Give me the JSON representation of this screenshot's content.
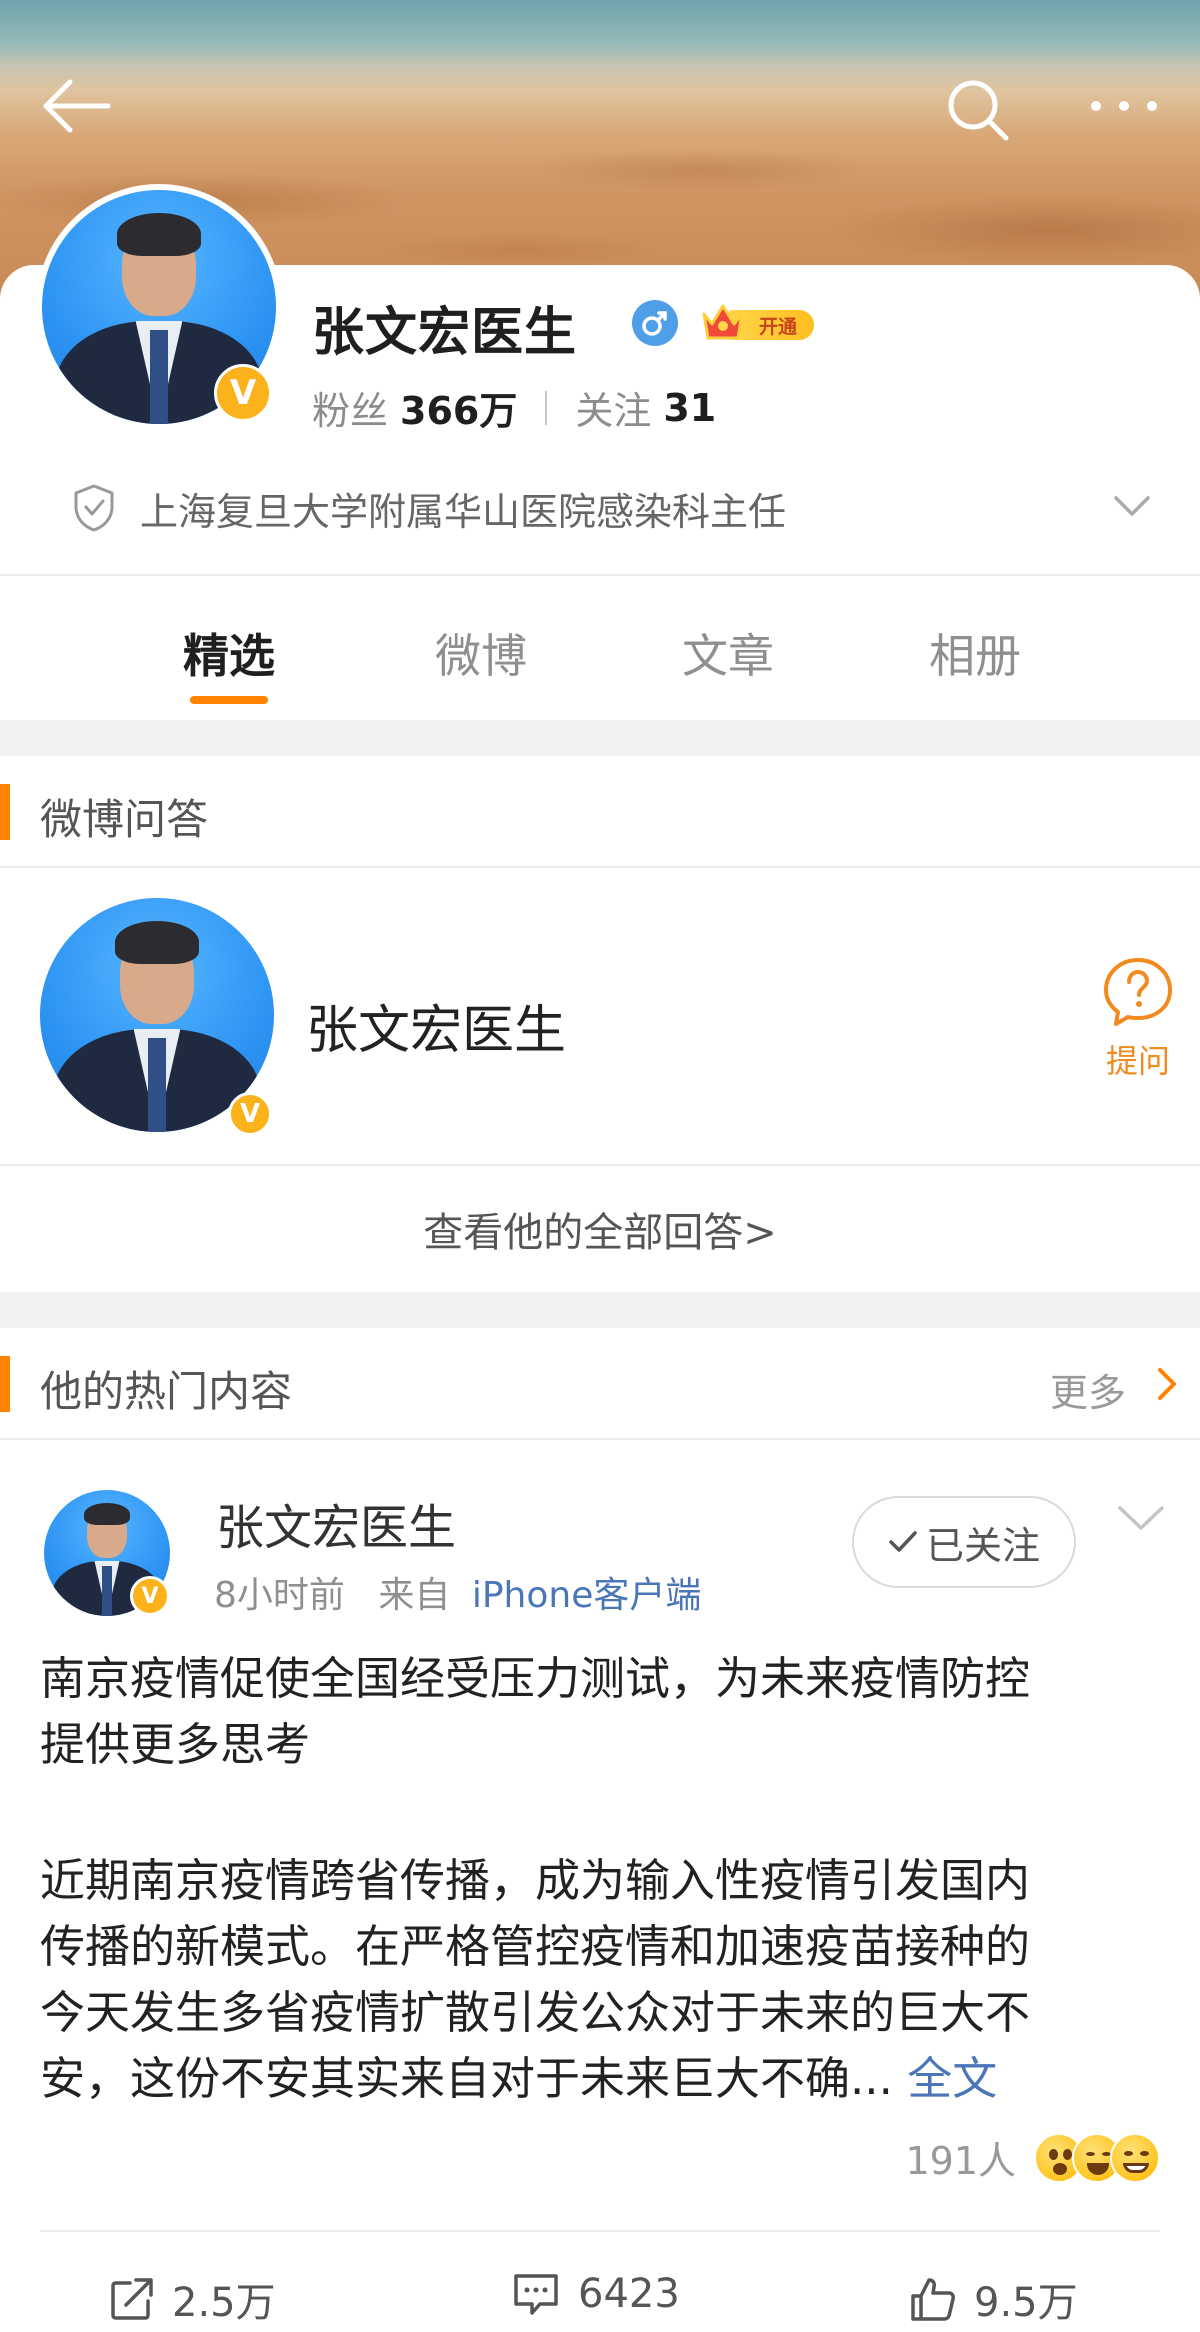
{
  "profile": {
    "name": "张文宏医生",
    "vip_label": "开通",
    "followers_label": "粉丝",
    "followers_count": "366万",
    "following_label": "关注",
    "following_count": "31",
    "certification": "上海复旦大学附属华山医院感染科主任"
  },
  "tabs": [
    {
      "label": "精选",
      "active": true
    },
    {
      "label": "微博",
      "active": false
    },
    {
      "label": "文章",
      "active": false
    },
    {
      "label": "相册",
      "active": false
    }
  ],
  "qa_section": {
    "title": "微博问答",
    "name": "张文宏医生",
    "ask_label": "提问",
    "all_answers": "查看他的全部回答>"
  },
  "hot_section": {
    "title": "他的热门内容",
    "more_label": "更多"
  },
  "post": {
    "author": "张文宏医生",
    "time": "8小时前",
    "from_label": "来自",
    "source": "iPhone客户端",
    "follow_label": "已关注",
    "headline_line1": "南京疫情促使全国经受压力测试，为未来疫情防控",
    "headline_line2": "提供更多思考",
    "body_line1": "近期南京疫情跨省传播，成为输入性疫情引发国内",
    "body_line2": "传播的新模式。在严格管控疫情和加速疫苗接种的",
    "body_line3": "今天发生多省疫情扩散引发公众对于未来的巨大不",
    "body_line4": "安，这份不安其实来自对于未来巨大不确...",
    "full_text_label": "全文",
    "reactions_count": "191人",
    "reposts": "2.5万",
    "comments": "6423",
    "likes": "9.5万"
  },
  "colors": {
    "accent": "#ff8200",
    "link": "#4a76b8",
    "verified": "#fbb21b",
    "gender": "#4e9ee8"
  }
}
